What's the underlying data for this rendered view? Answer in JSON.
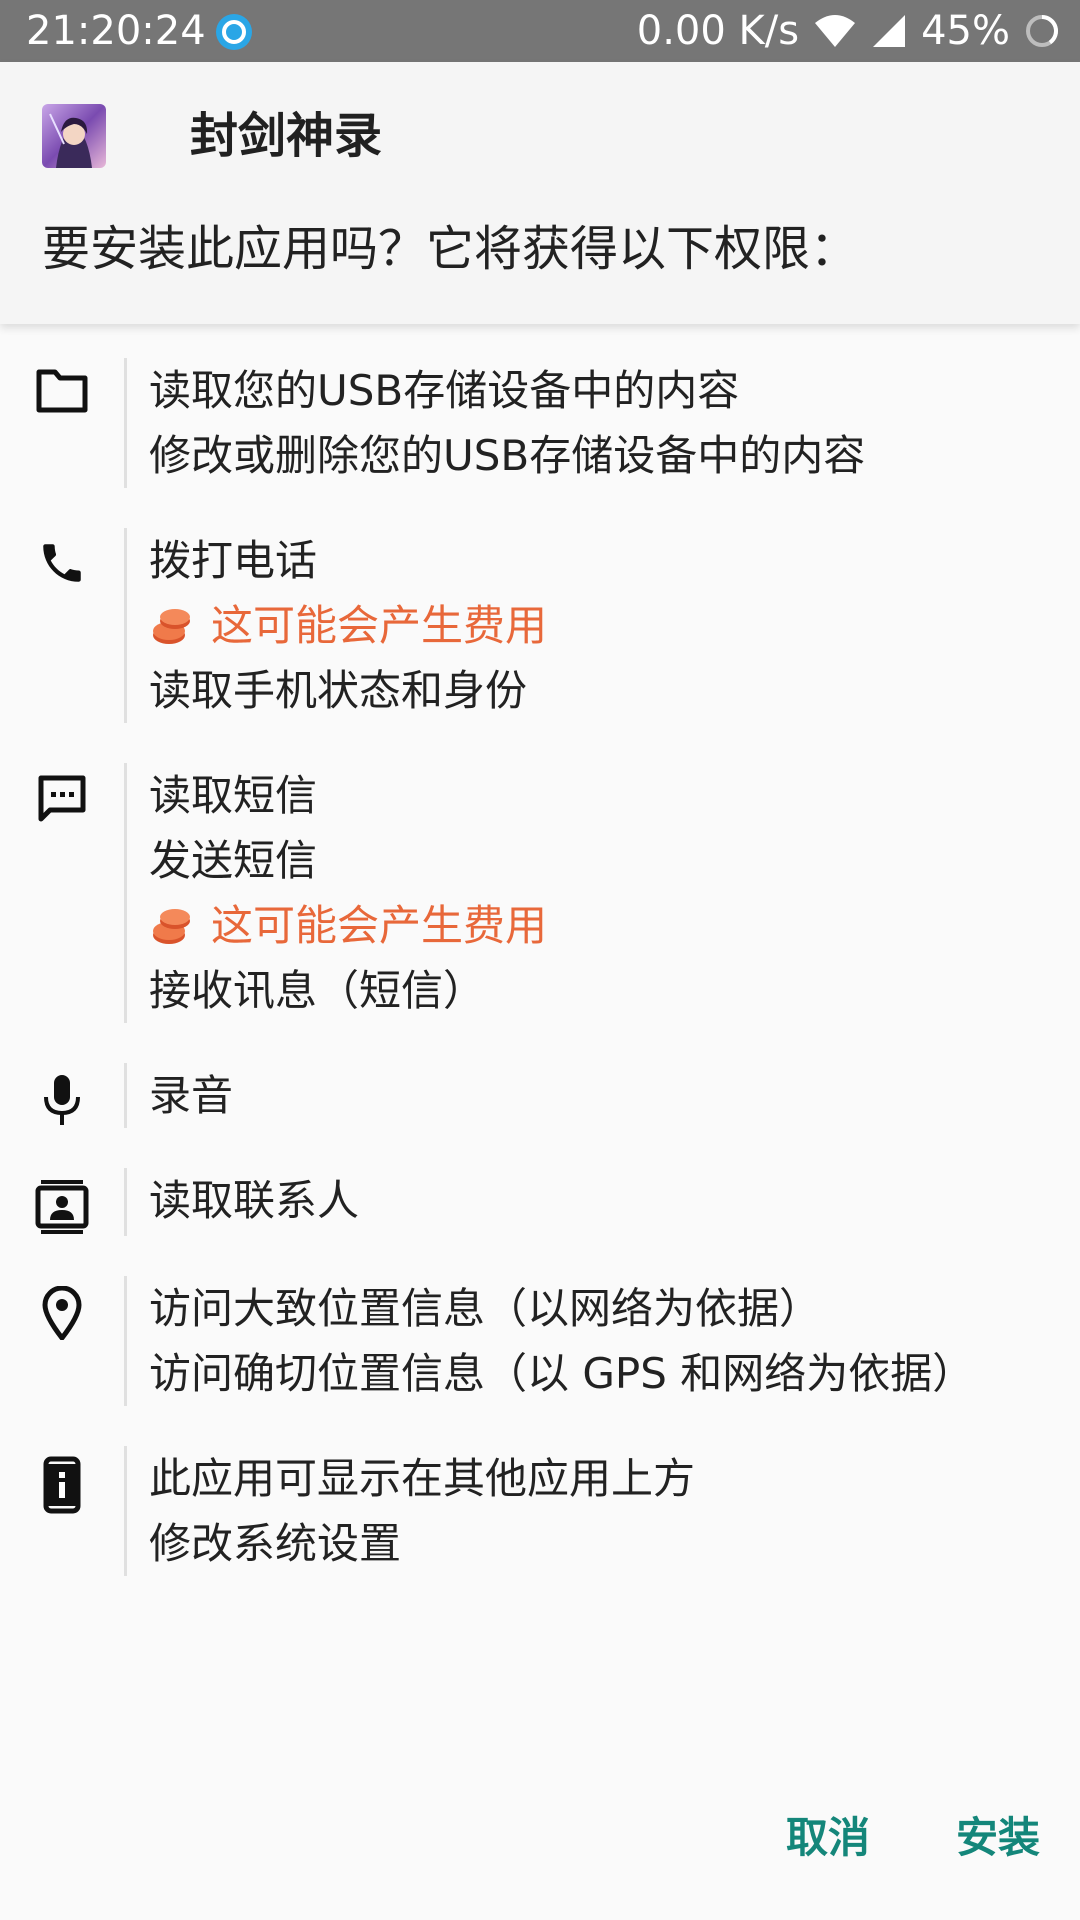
{
  "status_bar": {
    "time": "21:20:24",
    "net_speed": "0.00 K/s",
    "battery": "45%"
  },
  "header": {
    "app_name": "封剑神录",
    "prompt": "要安装此应用吗？它将获得以下权限："
  },
  "permissions": [
    {
      "icon": "folder-icon",
      "lines": [
        {
          "type": "normal",
          "text": "读取您的USB存储设备中的内容"
        },
        {
          "type": "normal",
          "text": "修改或删除您的USB存储设备中的内容"
        }
      ]
    },
    {
      "icon": "phone-icon",
      "lines": [
        {
          "type": "normal",
          "text": "拨打电话"
        },
        {
          "type": "warning",
          "text": "这可能会产生费用"
        },
        {
          "type": "normal",
          "text": "读取手机状态和身份"
        }
      ]
    },
    {
      "icon": "message-icon",
      "lines": [
        {
          "type": "normal",
          "text": "读取短信"
        },
        {
          "type": "normal",
          "text": "发送短信"
        },
        {
          "type": "warning",
          "text": "这可能会产生费用"
        },
        {
          "type": "normal",
          "text": "接收讯息（短信）"
        }
      ]
    },
    {
      "icon": "microphone-icon",
      "lines": [
        {
          "type": "normal",
          "text": "录音"
        }
      ]
    },
    {
      "icon": "contacts-icon",
      "lines": [
        {
          "type": "normal",
          "text": "读取联系人"
        }
      ]
    },
    {
      "icon": "location-pin-icon",
      "lines": [
        {
          "type": "normal",
          "text": "访问大致位置信息（以网络为依据）"
        },
        {
          "type": "normal",
          "text": "访问确切位置信息（以 GPS 和网络为依据）"
        }
      ]
    },
    {
      "icon": "device-info-icon",
      "lines": [
        {
          "type": "normal",
          "text": "此应用可显示在其他应用上方"
        },
        {
          "type": "normal",
          "text": "修改系统设置"
        }
      ]
    }
  ],
  "buttons": {
    "cancel": "取消",
    "install": "安装"
  },
  "colors": {
    "accent": "#14867a",
    "warning": "#e8683a",
    "status_bar": "#767676"
  }
}
